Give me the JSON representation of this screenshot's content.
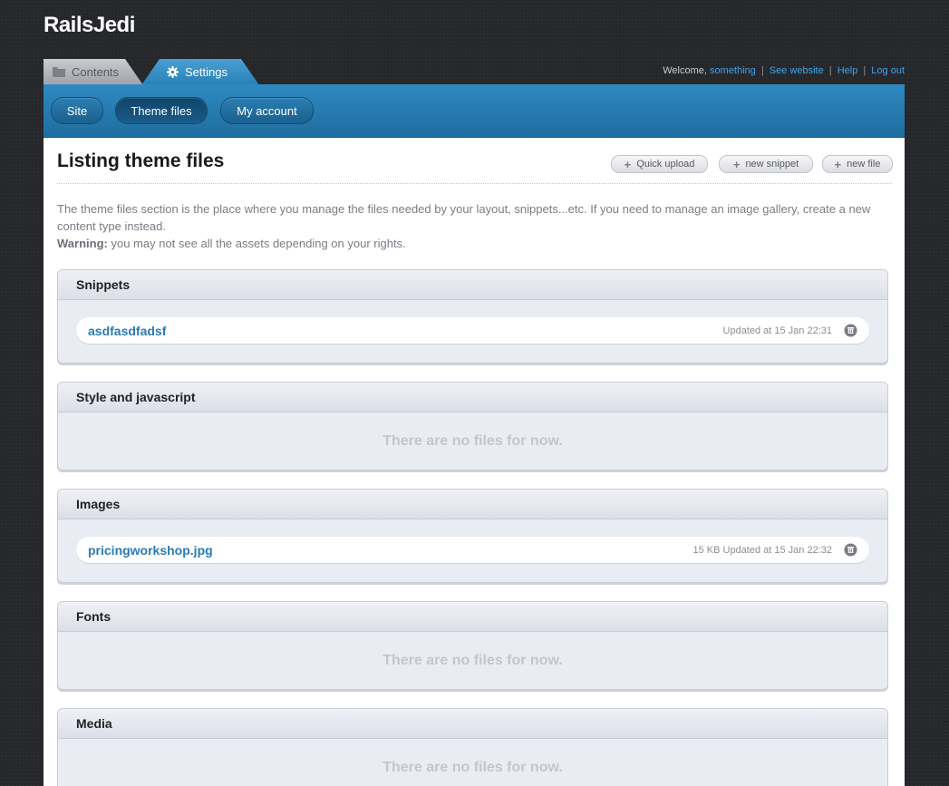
{
  "app": {
    "title": "RailsJedi"
  },
  "tabs": [
    {
      "label": "Contents",
      "icon": "folder-icon"
    },
    {
      "label": "Settings",
      "icon": "gear-icon"
    }
  ],
  "user_nav": {
    "welcome": "Welcome,",
    "username": "something",
    "see_website": "See website",
    "help": "Help",
    "logout": "Log out",
    "separator": "|"
  },
  "subnav": {
    "items": [
      {
        "label": "Site"
      },
      {
        "label": "Theme files",
        "active": true
      },
      {
        "label": "My account"
      }
    ]
  },
  "page": {
    "title": "Listing theme files",
    "actions": [
      {
        "label": "Quick upload",
        "icon": "plus-icon"
      },
      {
        "label": "new snippet",
        "icon": "plus-icon"
      },
      {
        "label": "new file",
        "icon": "plus-icon"
      }
    ],
    "description": "The theme files section is the place where you manage the files needed by your layout, snippets...etc. If you need to manage an image gallery, create a new content type instead.",
    "warning_label": "Warning:",
    "warning_text": "you may not see all the assets depending on your rights."
  },
  "sections": [
    {
      "title": "Snippets",
      "files": [
        {
          "name": "asdfasdfadsf",
          "meta": "Updated at 15 Jan 22:31"
        }
      ]
    },
    {
      "title": "Style and javascript",
      "empty_text": "There are no files for now."
    },
    {
      "title": "Images",
      "files": [
        {
          "name": "pricingworkshop.jpg",
          "meta": "15 KB Updated at 15 Jan 22:32"
        }
      ]
    },
    {
      "title": "Fonts",
      "empty_text": "There are no files for now."
    },
    {
      "title": "Media",
      "empty_text": "There are no files for now."
    }
  ],
  "colors": {
    "background": "#26272b",
    "accent_blue": "#2f8ac2",
    "link": "#2a7ab4",
    "section_bg": "#eaecf3"
  }
}
